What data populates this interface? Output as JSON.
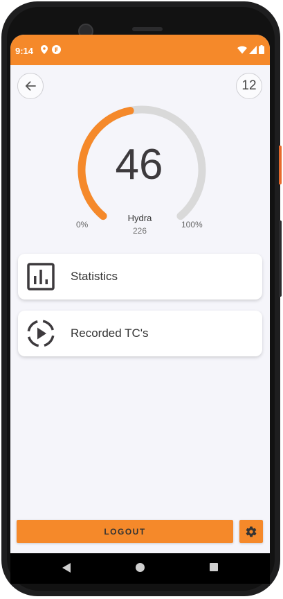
{
  "status_bar": {
    "time": "9:14",
    "icons_left": [
      "location-icon",
      "app-notification-icon"
    ],
    "icons_right": [
      "wifi-icon",
      "signal-icon",
      "battery-icon"
    ]
  },
  "header": {
    "back_icon": "arrow-left-icon",
    "count": "12"
  },
  "gauge": {
    "value": "46",
    "percent": 46,
    "min_label": "0%",
    "max_label": "100%",
    "name": "Hydra",
    "sub_value": "226",
    "colors": {
      "progress": "#f5892a",
      "track": "#d9d9d9"
    }
  },
  "menu": {
    "statistics_label": "Statistics",
    "statistics_icon": "bar-chart-icon",
    "recorded_label": "Recorded TC's",
    "recorded_icon": "play-circle-dashed-icon"
  },
  "footer": {
    "logout_label": "LOGOUT",
    "settings_icon": "gear-icon"
  },
  "colors": {
    "accent": "#f5892a",
    "background": "#f5f5fa"
  },
  "nav_bar": {
    "icons": [
      "nav-back-icon",
      "nav-home-icon",
      "nav-recents-icon"
    ]
  }
}
